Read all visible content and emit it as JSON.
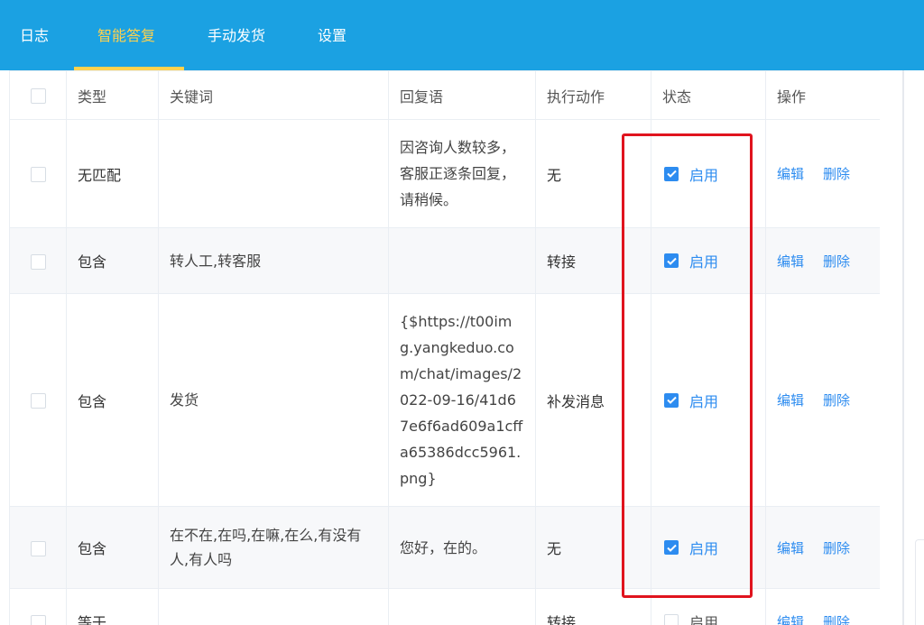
{
  "nav": {
    "tabs": [
      {
        "label": "日志",
        "active": false
      },
      {
        "label": "智能答复",
        "active": true
      },
      {
        "label": "手动发货",
        "active": false
      },
      {
        "label": "设置",
        "active": false
      }
    ]
  },
  "table": {
    "columns": [
      "类型",
      "关键词",
      "回复语",
      "执行动作",
      "状态",
      "操作"
    ],
    "rows": [
      {
        "type": "无匹配",
        "keyword": "",
        "reply": "因咨询人数较多，客服正逐条回复，请稍候。",
        "action": "无",
        "status_label": "启用",
        "enabled": true,
        "edit": "编辑",
        "delete": "删除"
      },
      {
        "type": "包含",
        "keyword": "转人工,转客服",
        "reply": "",
        "action": "转接",
        "status_label": "启用",
        "enabled": true,
        "edit": "编辑",
        "delete": "删除"
      },
      {
        "type": "包含",
        "keyword": "发货",
        "reply": "{$https://t00img.yangkeduo.com/chat/images/2022-09-16/41d67e6f6ad609a1cffa65386dcc5961.png}",
        "action": "补发消息",
        "status_label": "启用",
        "enabled": true,
        "edit": "编辑",
        "delete": "删除"
      },
      {
        "type": "包含",
        "keyword": "在不在,在吗,在嘛,在么,有没有人,有人吗",
        "reply": "您好，在的。",
        "action": "无",
        "status_label": "启用",
        "enabled": true,
        "edit": "编辑",
        "delete": "删除"
      },
      {
        "type": "等于",
        "keyword": "",
        "reply": "",
        "action": "转接",
        "status_label": "启用",
        "enabled": false,
        "edit": "编辑",
        "delete": "删除"
      }
    ]
  },
  "colors": {
    "header_bar": "#1ba1e2",
    "active_tab": "#ffd24d",
    "link": "#2d8cf0",
    "highlight": "#e0141e"
  }
}
